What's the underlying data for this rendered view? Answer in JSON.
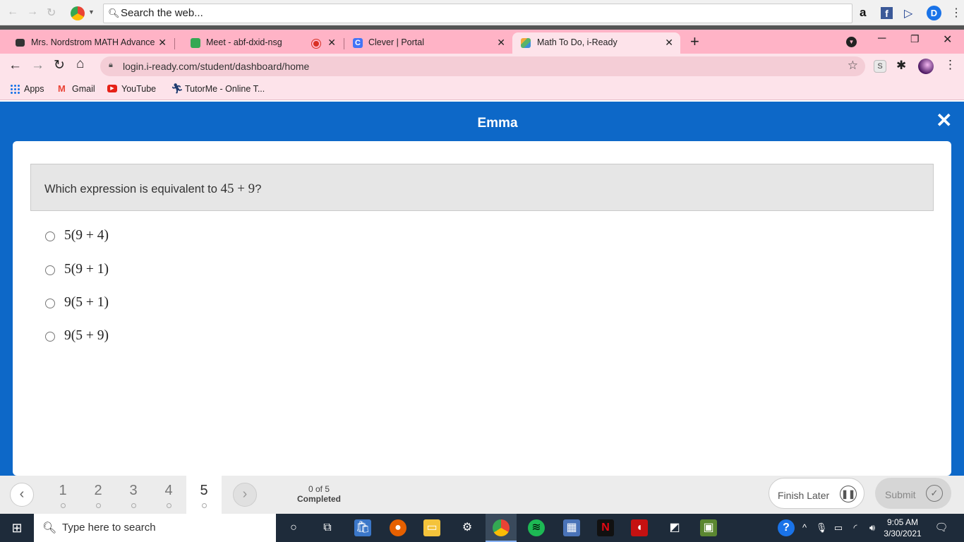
{
  "outer_browser": {
    "search_text": "Search the web..."
  },
  "tabs": [
    {
      "label": "Mrs. Nordstrom MATH Advancec",
      "favicon_color": "#333333"
    },
    {
      "label": "Meet - abf-dxid-nsg",
      "favicon_color": "#34a853"
    },
    {
      "label": "Clever | Portal",
      "favicon_color": "#4274f6"
    },
    {
      "label": "Math To Do, i-Ready",
      "favicon_color": "#59b36b"
    }
  ],
  "address_bar": {
    "url": "login.i-ready.com/student/dashboard/home"
  },
  "bookmarks": [
    {
      "label": "Apps"
    },
    {
      "label": "Gmail"
    },
    {
      "label": "YouTube"
    },
    {
      "label": "TutorMe - Online T..."
    }
  ],
  "app": {
    "title": "Emma",
    "close_glyph": "✕",
    "accent_color": "#0d68c8"
  },
  "question": {
    "prompt_prefix": "Which expression is equivalent to ",
    "prompt_math": "45 + 9",
    "prompt_suffix": "?"
  },
  "options": [
    {
      "label": "5(9 + 4)"
    },
    {
      "label": "5(9 + 1)"
    },
    {
      "label": "9(5 + 1)"
    },
    {
      "label": "9(5 + 9)"
    }
  ],
  "bottom_nav": {
    "prev_glyph": "‹",
    "next_glyph": "›",
    "questions": [
      "1",
      "2",
      "3",
      "4",
      "5"
    ],
    "active_question": "5",
    "progress_count": "0 of 5",
    "progress_label": "Completed",
    "finish_label": "Finish Later",
    "submit_label": "Submit"
  },
  "taskbar": {
    "search_placeholder": "Type here to search",
    "time": "9:05 AM",
    "date": "3/30/2021"
  }
}
